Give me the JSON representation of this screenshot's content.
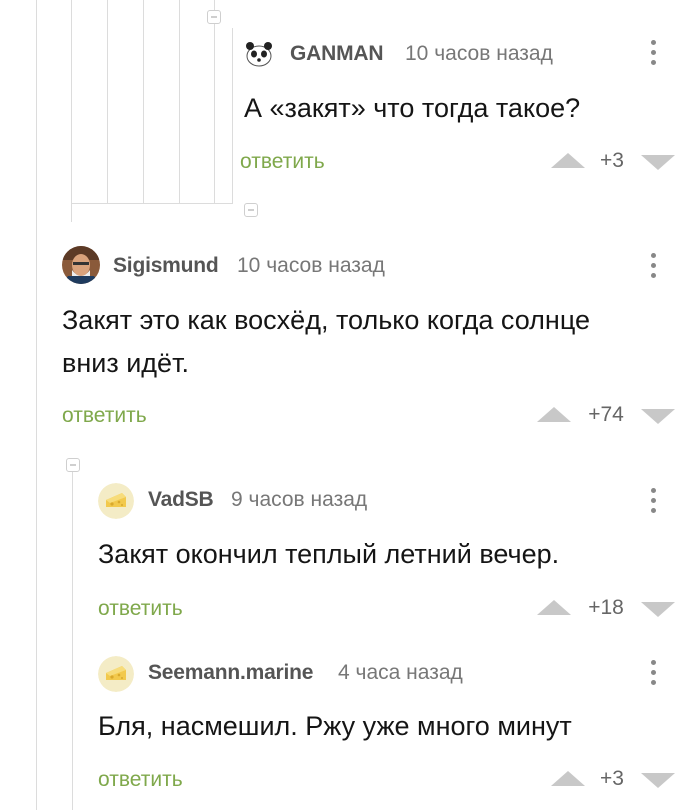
{
  "comments": [
    {
      "author": "GANMAN",
      "time": "10 часов назад",
      "text": "А «закят» что тогда такое?",
      "reply_label": "ответить",
      "rating": "+3",
      "avatar_icon": "panda-avatar-icon"
    },
    {
      "author": "Sigismund",
      "time": "10 часов назад",
      "text_line1": "Закят это как восхёд, только когда солнце",
      "text_line2": "вниз идёт.",
      "reply_label": "ответить",
      "rating": "+74",
      "avatar_icon": "user-photo-avatar"
    },
    {
      "author": "VadSB",
      "time": "9 часов назад",
      "text": "Закят окончил теплый летний вечер.",
      "reply_label": "ответить",
      "rating": "+18",
      "avatar_icon": "cheese-avatar-icon"
    },
    {
      "author": "Seemann.marine",
      "time": "4 часа назад",
      "text": "Бля, насмешил. Ржу уже много минут",
      "reply_label": "ответить",
      "rating": "+3",
      "avatar_icon": "cheese-avatar-icon"
    }
  ],
  "colors": {
    "reply": "#7fa84b",
    "thread_line": "#dcdcdc",
    "vote_arrow": "#c8c8c8"
  }
}
